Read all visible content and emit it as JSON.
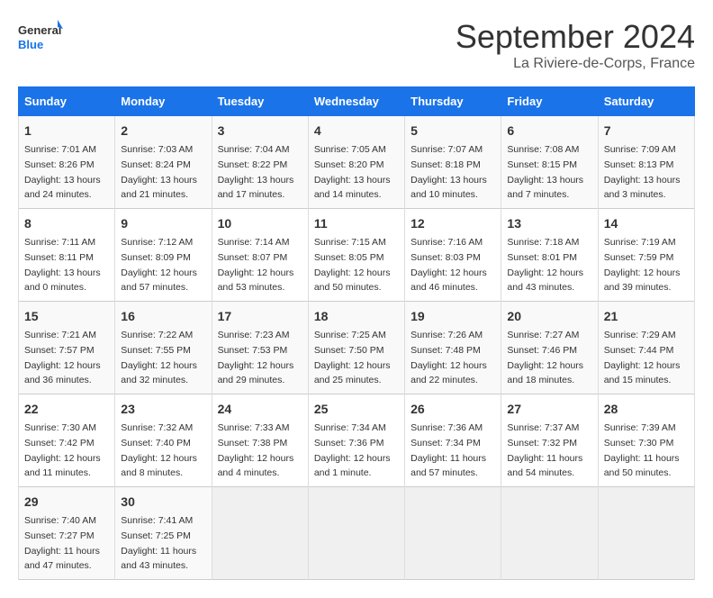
{
  "logo": {
    "line1": "General",
    "line2": "Blue"
  },
  "title": "September 2024",
  "subtitle": "La Riviere-de-Corps, France",
  "days_header": [
    "Sunday",
    "Monday",
    "Tuesday",
    "Wednesday",
    "Thursday",
    "Friday",
    "Saturday"
  ],
  "weeks": [
    [
      {
        "day": "1",
        "info": "Sunrise: 7:01 AM\nSunset: 8:26 PM\nDaylight: 13 hours\nand 24 minutes."
      },
      {
        "day": "2",
        "info": "Sunrise: 7:03 AM\nSunset: 8:24 PM\nDaylight: 13 hours\nand 21 minutes."
      },
      {
        "day": "3",
        "info": "Sunrise: 7:04 AM\nSunset: 8:22 PM\nDaylight: 13 hours\nand 17 minutes."
      },
      {
        "day": "4",
        "info": "Sunrise: 7:05 AM\nSunset: 8:20 PM\nDaylight: 13 hours\nand 14 minutes."
      },
      {
        "day": "5",
        "info": "Sunrise: 7:07 AM\nSunset: 8:18 PM\nDaylight: 13 hours\nand 10 minutes."
      },
      {
        "day": "6",
        "info": "Sunrise: 7:08 AM\nSunset: 8:15 PM\nDaylight: 13 hours\nand 7 minutes."
      },
      {
        "day": "7",
        "info": "Sunrise: 7:09 AM\nSunset: 8:13 PM\nDaylight: 13 hours\nand 3 minutes."
      }
    ],
    [
      {
        "day": "8",
        "info": "Sunrise: 7:11 AM\nSunset: 8:11 PM\nDaylight: 13 hours\nand 0 minutes."
      },
      {
        "day": "9",
        "info": "Sunrise: 7:12 AM\nSunset: 8:09 PM\nDaylight: 12 hours\nand 57 minutes."
      },
      {
        "day": "10",
        "info": "Sunrise: 7:14 AM\nSunset: 8:07 PM\nDaylight: 12 hours\nand 53 minutes."
      },
      {
        "day": "11",
        "info": "Sunrise: 7:15 AM\nSunset: 8:05 PM\nDaylight: 12 hours\nand 50 minutes."
      },
      {
        "day": "12",
        "info": "Sunrise: 7:16 AM\nSunset: 8:03 PM\nDaylight: 12 hours\nand 46 minutes."
      },
      {
        "day": "13",
        "info": "Sunrise: 7:18 AM\nSunset: 8:01 PM\nDaylight: 12 hours\nand 43 minutes."
      },
      {
        "day": "14",
        "info": "Sunrise: 7:19 AM\nSunset: 7:59 PM\nDaylight: 12 hours\nand 39 minutes."
      }
    ],
    [
      {
        "day": "15",
        "info": "Sunrise: 7:21 AM\nSunset: 7:57 PM\nDaylight: 12 hours\nand 36 minutes."
      },
      {
        "day": "16",
        "info": "Sunrise: 7:22 AM\nSunset: 7:55 PM\nDaylight: 12 hours\nand 32 minutes."
      },
      {
        "day": "17",
        "info": "Sunrise: 7:23 AM\nSunset: 7:53 PM\nDaylight: 12 hours\nand 29 minutes."
      },
      {
        "day": "18",
        "info": "Sunrise: 7:25 AM\nSunset: 7:50 PM\nDaylight: 12 hours\nand 25 minutes."
      },
      {
        "day": "19",
        "info": "Sunrise: 7:26 AM\nSunset: 7:48 PM\nDaylight: 12 hours\nand 22 minutes."
      },
      {
        "day": "20",
        "info": "Sunrise: 7:27 AM\nSunset: 7:46 PM\nDaylight: 12 hours\nand 18 minutes."
      },
      {
        "day": "21",
        "info": "Sunrise: 7:29 AM\nSunset: 7:44 PM\nDaylight: 12 hours\nand 15 minutes."
      }
    ],
    [
      {
        "day": "22",
        "info": "Sunrise: 7:30 AM\nSunset: 7:42 PM\nDaylight: 12 hours\nand 11 minutes."
      },
      {
        "day": "23",
        "info": "Sunrise: 7:32 AM\nSunset: 7:40 PM\nDaylight: 12 hours\nand 8 minutes."
      },
      {
        "day": "24",
        "info": "Sunrise: 7:33 AM\nSunset: 7:38 PM\nDaylight: 12 hours\nand 4 minutes."
      },
      {
        "day": "25",
        "info": "Sunrise: 7:34 AM\nSunset: 7:36 PM\nDaylight: 12 hours\nand 1 minute."
      },
      {
        "day": "26",
        "info": "Sunrise: 7:36 AM\nSunset: 7:34 PM\nDaylight: 11 hours\nand 57 minutes."
      },
      {
        "day": "27",
        "info": "Sunrise: 7:37 AM\nSunset: 7:32 PM\nDaylight: 11 hours\nand 54 minutes."
      },
      {
        "day": "28",
        "info": "Sunrise: 7:39 AM\nSunset: 7:30 PM\nDaylight: 11 hours\nand 50 minutes."
      }
    ],
    [
      {
        "day": "29",
        "info": "Sunrise: 7:40 AM\nSunset: 7:27 PM\nDaylight: 11 hours\nand 47 minutes."
      },
      {
        "day": "30",
        "info": "Sunrise: 7:41 AM\nSunset: 7:25 PM\nDaylight: 11 hours\nand 43 minutes."
      },
      {
        "day": "",
        "info": ""
      },
      {
        "day": "",
        "info": ""
      },
      {
        "day": "",
        "info": ""
      },
      {
        "day": "",
        "info": ""
      },
      {
        "day": "",
        "info": ""
      }
    ]
  ]
}
